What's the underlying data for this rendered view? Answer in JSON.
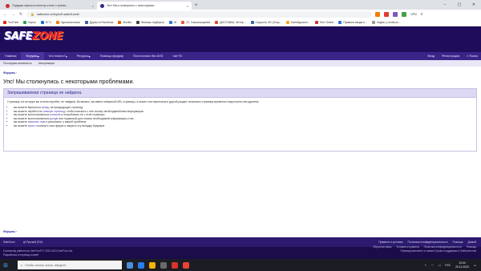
{
  "browser": {
    "tabs": [
      {
        "label": "Подарки офисы в ментор-столе с тремя...",
        "favicon_color": "#cc2a2a",
        "active": false
      },
      {
        "label": "Упс! Мы столкнулись с некоторыми...",
        "favicon_color": "#2a2a8a",
        "active": true
      }
    ],
    "new_tab": "+",
    "window_controls": {
      "minimize": "–",
      "maximize": "▢",
      "close": "✕"
    },
    "url": "safezone.cc/topic/it-safe/it-web/",
    "bookmarks": [
      {
        "label": "YouTube",
        "color": "#e62117"
      },
      {
        "label": "Карты",
        "color": "#2e9d4a"
      },
      {
        "label": "ЕГЭ",
        "color": "#1e6ad8"
      },
      {
        "label": "Одноклассники",
        "color": "#ee8208"
      },
      {
        "label": "Друзья в Facebook",
        "color": "#3a5a99"
      },
      {
        "label": "Mozilla",
        "color": "#e66000"
      },
      {
        "label": "Фильмы подборка",
        "color": "#444"
      },
      {
        "label": "Gt",
        "color": "#2a7ae2"
      },
      {
        "label": "22. Самоочищение",
        "color": "#e54"
      },
      {
        "label": "ДОСТАВКА. Интер...",
        "color": "#e04a2b"
      },
      {
        "label": "Скорость 3G (Скор...",
        "color": "#36a"
      },
      {
        "label": "Калейдоскоп...",
        "color": "#f5a623"
      },
      {
        "label": "Тест Online",
        "color": "#c33"
      },
      {
        "label": "Правила ввода в...",
        "color": "#2f6fde"
      },
      {
        "label": "Vagfon_Lonolicon...",
        "color": "#999"
      }
    ],
    "vpn_label": "VPN"
  },
  "site": {
    "logo_main": "SAFE",
    "logo_accent": "ZONE",
    "nav": [
      {
        "label": "Главная",
        "active": false
      },
      {
        "label": "Форумы",
        "active": true
      },
      {
        "label": "Что нового?",
        "active": false
      },
      {
        "label": "Ресурсы",
        "active": false
      },
      {
        "label": "Помощь форуму",
        "active": false
      },
      {
        "label": "Потолочные без АНЗ",
        "active": false
      },
      {
        "label": "Чат?!0",
        "active": false
      }
    ],
    "nav_right": {
      "login": "Вход",
      "register": "Регистрация",
      "search": "Поиск"
    },
    "subnav": [
      "Последняя активность",
      "Авторизация"
    ],
    "breadcrumb": "Форумы",
    "page_title": "Упс! Мы столкнулись с некоторыми проблемами.",
    "notice": {
      "title": "Запрашиваемая страница не найдена.",
      "intro": "Страница, на которую вы хотели перейти, не найдена. Возможно, вы ввели неверный URL-страницы, а может она переехала в другой раздел, возможно страница временно недоступна или удалена.",
      "items": [
        "вы можете вернуться назад, на предыдущую страницу",
        "вы можете перейти на главную страницу, чтобы поискать с нее ссылку необходимой вам информации",
        "вы можете воспользоваться поиском и попробовать ее с этой страницы",
        "вы можете воспользоваться google или подпиской для поиска необходимой информации у нас",
        "вы можете написать нам и рассказать о вашей проблеме",
        "вы можете просто покинуть наш форум и закрыть эту вкладку браузера"
      ]
    },
    "bottom_breadcrumb": "Форумы",
    "footer": {
      "left": [
        "SafeZone",
        "Русский (RU)"
      ],
      "right": [
        "Правила и условия",
        "Политика конфиденциальности",
        "Помощь",
        "Домой"
      ],
      "right_top": [
        "Обратная связь",
        "Условия и правила",
        "Политика конфиденциальности",
        "Помощь"
      ],
      "copyright": "Community platform by XenForo® © 2010-2024 XenForo Ltd.",
      "credits": "Разработка и перевод стилей",
      "right_note": "Перевод выполнен от имени Группы поддержки и Любопытства"
    }
  },
  "taskbar": {
    "search_placeholder": "Чтобы начать поиск, введите",
    "icons": [
      "#4a90d9",
      "#2b7de9",
      "#f4b400",
      "#6a6a6a",
      "#d6332c",
      "#ea4335"
    ],
    "lang": "РУС",
    "time": "13:44",
    "date": "20.11.2023"
  }
}
